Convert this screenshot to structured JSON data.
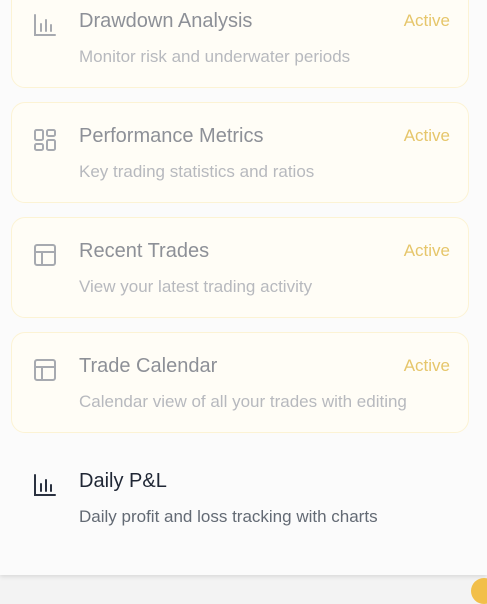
{
  "widgets": [
    {
      "title": "Drawdown Analysis",
      "description": "Monitor risk and underwater periods",
      "status": "Active",
      "icon": "bar-chart-icon"
    },
    {
      "title": "Performance Metrics",
      "description": "Key trading statistics and ratios",
      "status": "Active",
      "icon": "dashboard-grid-icon"
    },
    {
      "title": "Recent Trades",
      "description": "View your latest trading activity",
      "status": "Active",
      "icon": "layout-panel-icon"
    },
    {
      "title": "Trade Calendar",
      "description": "Calendar view of all your trades with editing",
      "status": "Active",
      "icon": "layout-panel-icon"
    },
    {
      "title": "Daily P&L",
      "description": "Daily profit and loss tracking with charts",
      "icon": "bar-chart-icon"
    }
  ],
  "colors": {
    "active_card_background": "#fffdf6",
    "active_card_border": "#fcf3d4",
    "active_status_text": "#e6c66b",
    "muted_title": "#8d9097",
    "muted_description": "#b7b9be",
    "default_title": "#1f2634",
    "default_description": "#636a74",
    "corner_badge": "#f2bf4a"
  }
}
